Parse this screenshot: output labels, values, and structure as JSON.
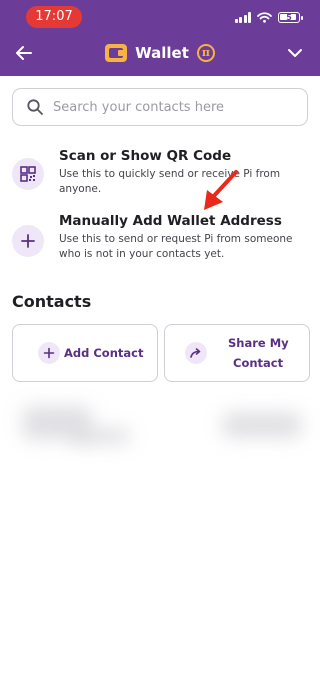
{
  "status_bar": {
    "time": "17:07",
    "battery_level": "5",
    "accent_color": "#e53935"
  },
  "header": {
    "title": "Wallet",
    "pi_symbol": "π",
    "background_color": "#6b3d98",
    "icons": [
      "arrow-left-icon",
      "wallet-icon",
      "pi-coin-icon",
      "chevron-down-icon"
    ]
  },
  "search": {
    "placeholder": "Search your contacts here",
    "value": ""
  },
  "options": [
    {
      "title": "Scan or Show QR Code",
      "description": "Use this to quickly send or receive Pi from anyone.",
      "icon": "qr-code-icon"
    },
    {
      "title": "Manually Add Wallet Address",
      "description": "Use this to send or request Pi from someone who is not in your contacts yet.",
      "icon": "plus-icon"
    }
  ],
  "contacts": {
    "heading": "Contacts",
    "add_contact_label": "Add Contact",
    "share_contact_label_line1": "Share My",
    "share_contact_label_line2": "Contact"
  },
  "annotation_color": "#e8291c"
}
